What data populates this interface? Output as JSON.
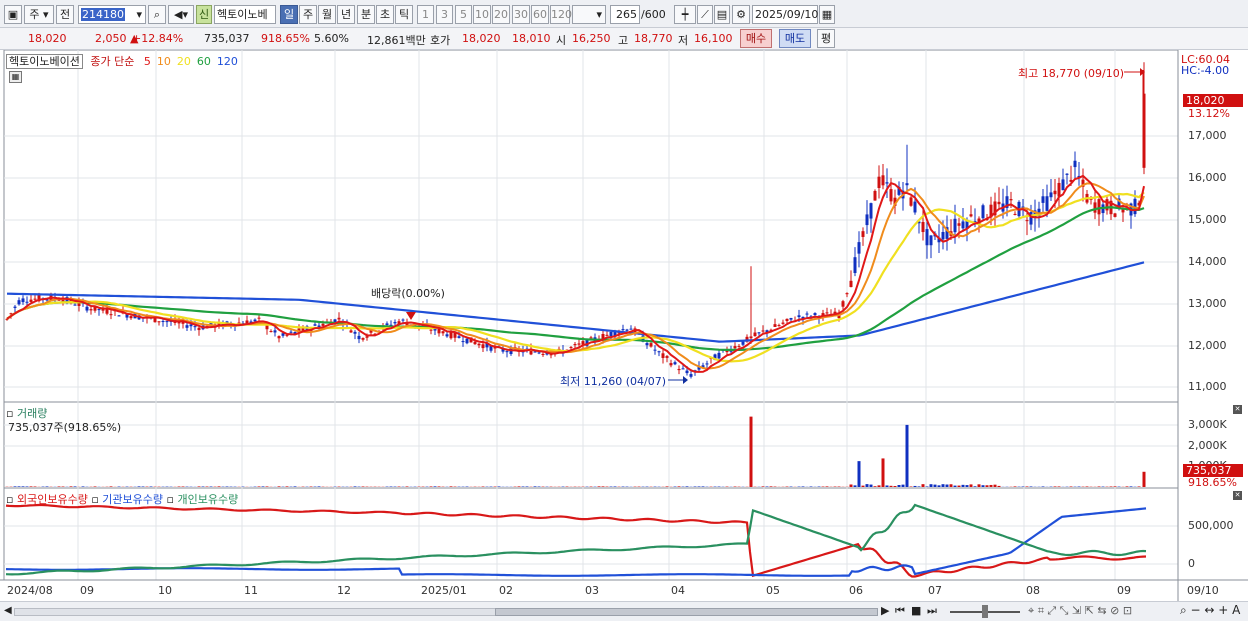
{
  "toolbar": {
    "period_label": "주",
    "prev_label": "전",
    "code": "214180",
    "badge": "신",
    "name": "헥토이노베",
    "periods": [
      "일",
      "주",
      "월",
      "년",
      "분",
      "초",
      "틱"
    ],
    "intervals": [
      "1",
      "3",
      "5",
      "10",
      "20",
      "30",
      "60",
      "120"
    ],
    "count": "265",
    "count_max": "/600",
    "date": "2025/09/10"
  },
  "quote": {
    "price": "18,020",
    "change": "2,050",
    "change_pct": "+12.84%",
    "volume": "735,037",
    "volume_pct": "918.65%",
    "turnover": "5.60%",
    "amount": "12,861백만",
    "hoga_label": "호가",
    "ask": "18,020",
    "bid": "18,010",
    "open_label": "시",
    "open": "16,250",
    "high_label": "고",
    "high": "18,770",
    "low_label": "저",
    "low": "16,100",
    "buy_btn": "매수",
    "sell_btn": "매도",
    "eval_btn": "평"
  },
  "price_panel": {
    "legend_name": "헥토이노베이션",
    "legend_ma": "종가 단순",
    "ma_periods": [
      "5",
      "10",
      "20",
      "60",
      "120"
    ],
    "lc": "LC:60.04",
    "hc": "HC:-4.00",
    "high_marker": "최고 18,770 (09/10)",
    "low_marker": "최저 11,260 (04/07)",
    "dividend": "배당락(0.00%)",
    "current_price": "18,020",
    "current_pct": "13.12%",
    "y_ticks": [
      "17,000",
      "16,000",
      "15,000",
      "14,000",
      "13,000",
      "12,000",
      "11,000"
    ]
  },
  "volume_panel": {
    "title": "거래량",
    "value": "735,037주(918.65%)",
    "y_ticks": [
      "3,000K",
      "2,000K",
      "1,000K"
    ],
    "current": "735,037",
    "current_pct": "918.65%"
  },
  "holding_panel": {
    "legend": [
      "외국인보유수량",
      "기관보유수량",
      "개인보유수량"
    ],
    "y_ticks": [
      "500,000",
      "0"
    ]
  },
  "x_axis": [
    "2024/08",
    "09",
    "10",
    "11",
    "12",
    "2025/01",
    "02",
    "03",
    "04",
    "05",
    "06",
    "07",
    "08",
    "09"
  ],
  "x_last": "09/10",
  "colors": {
    "up": "#d01010",
    "down": "#1030c0",
    "ma5": "#e01818",
    "ma10": "#f08c1c",
    "ma20": "#f0e020",
    "ma60": "#20a040",
    "ma120": "#2050d8",
    "foreign": "#d81818",
    "inst": "#2050d8",
    "retail": "#2a9060"
  }
}
